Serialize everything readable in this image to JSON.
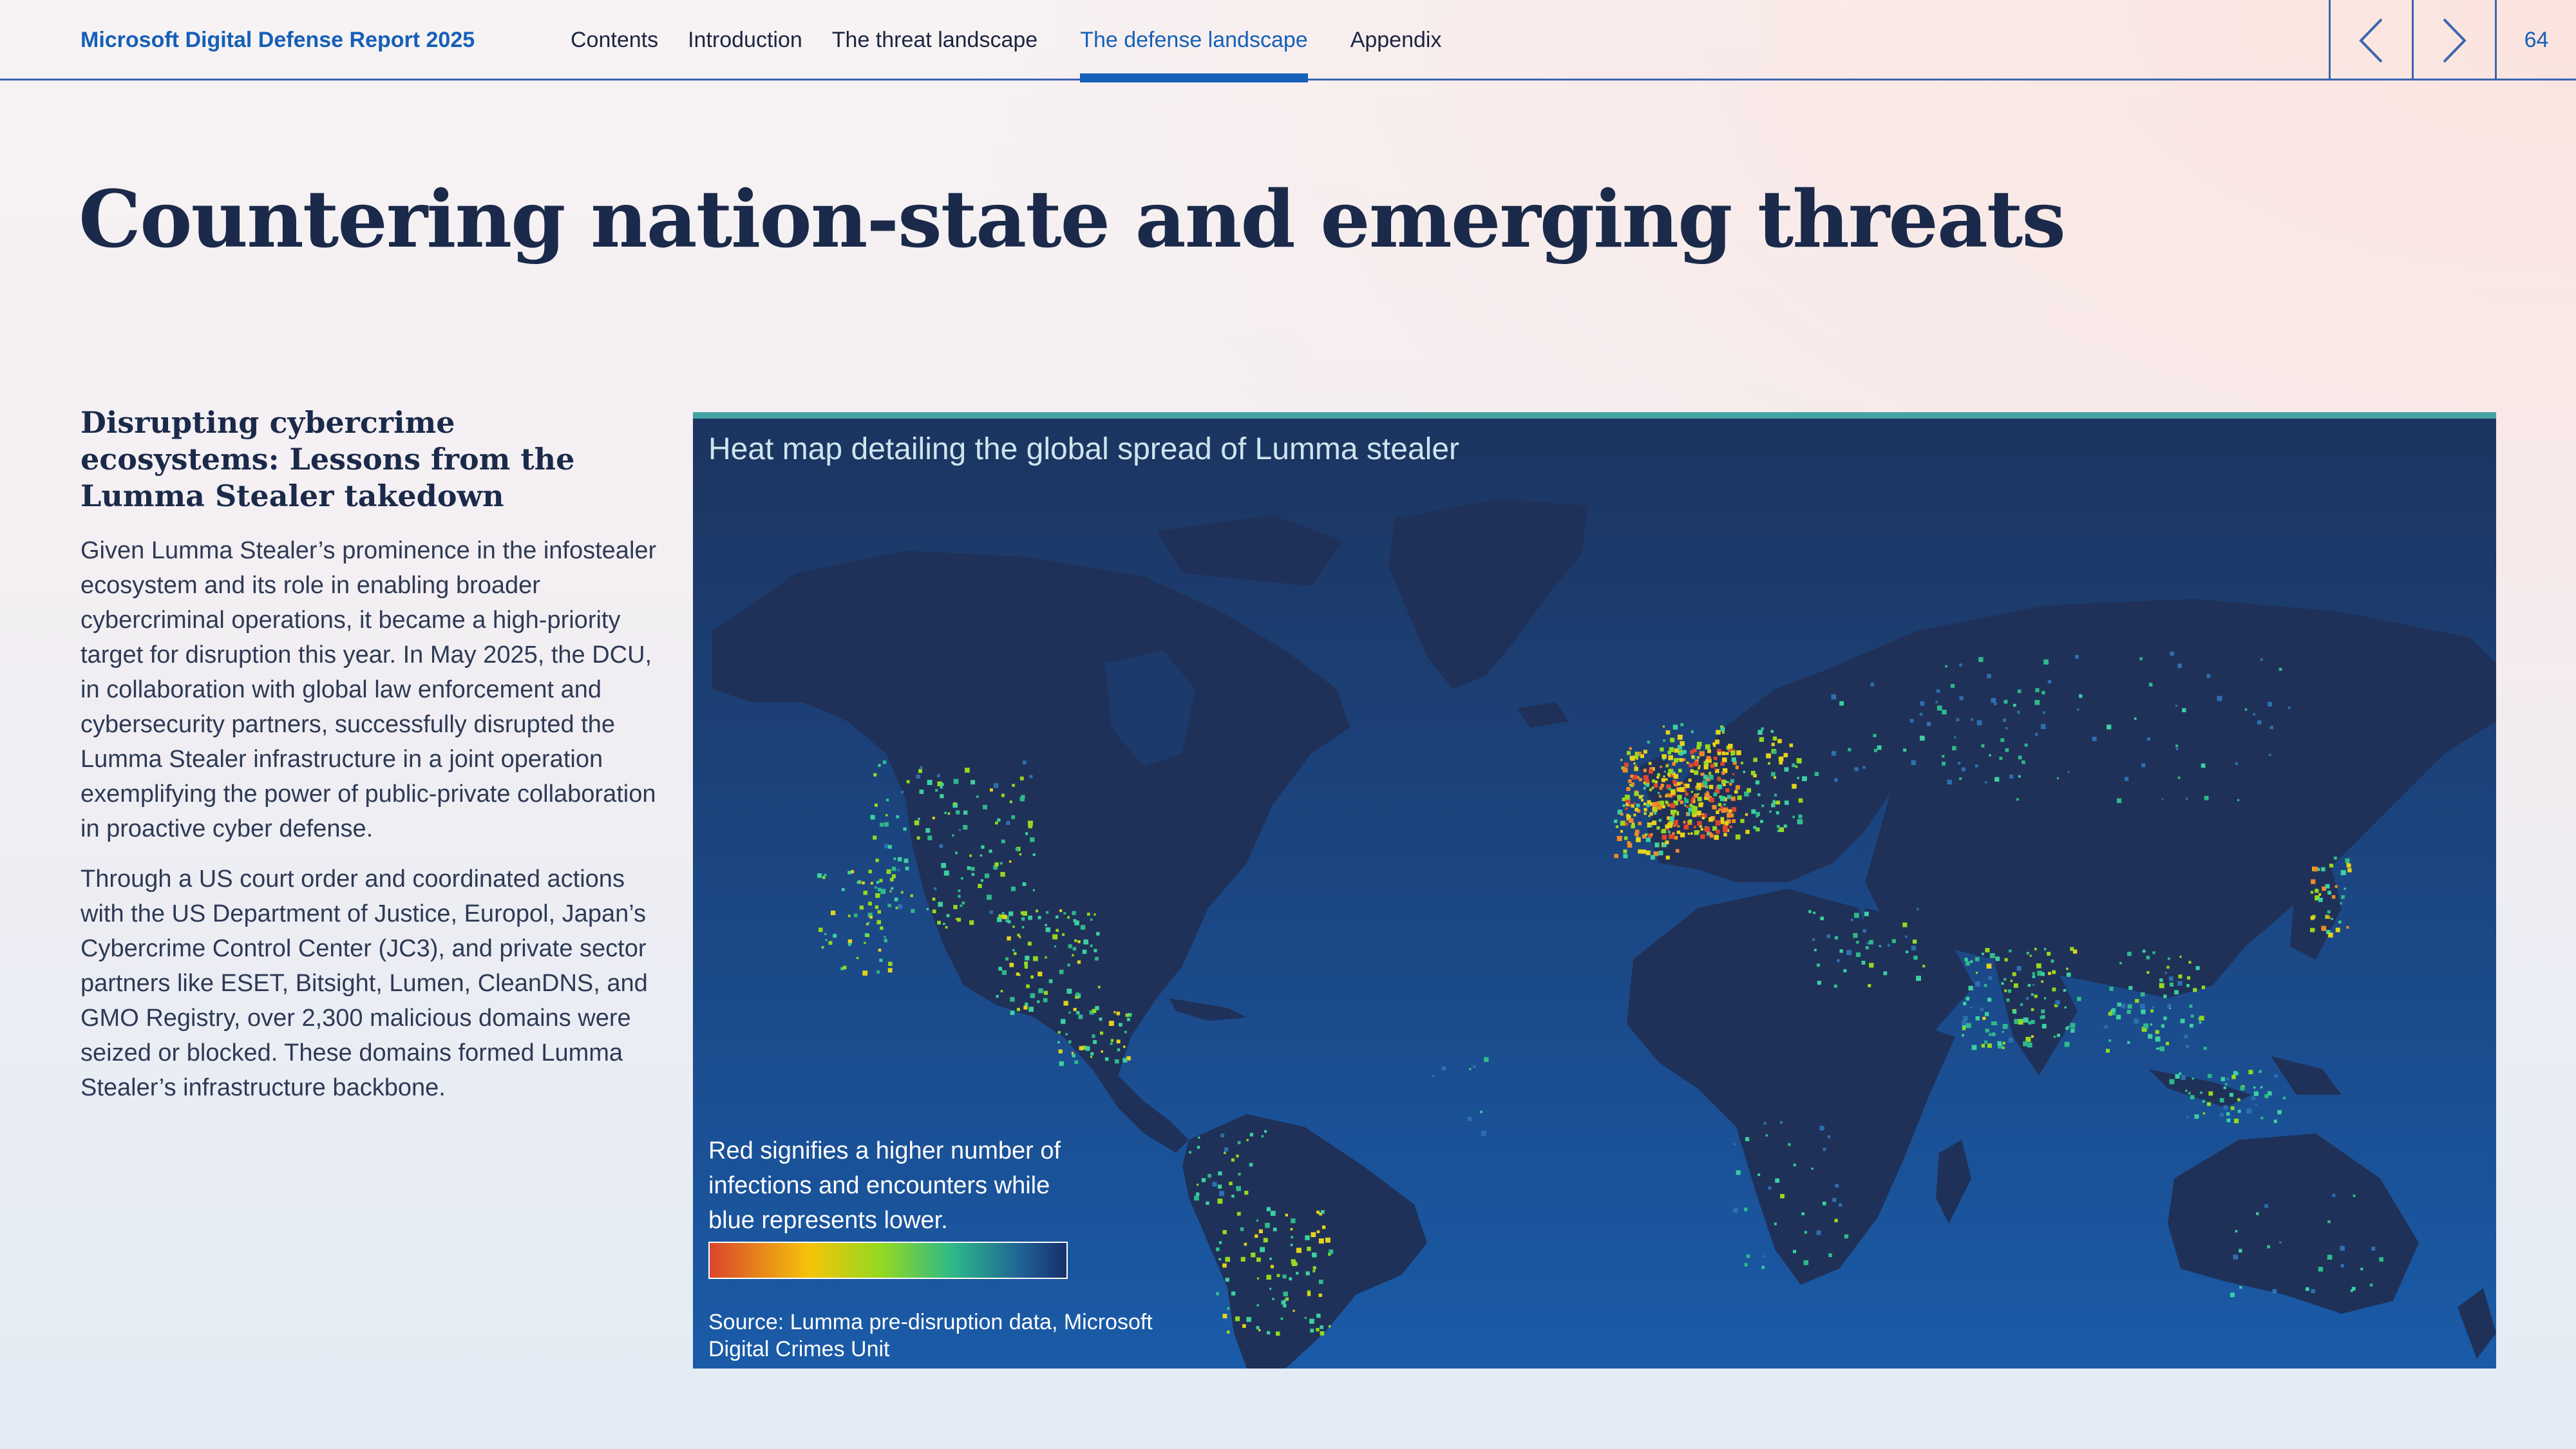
{
  "header": {
    "brand": "Microsoft Digital Defense Report 2025",
    "nav": [
      {
        "label": "Contents",
        "active": false
      },
      {
        "label": "Introduction",
        "active": false
      },
      {
        "label": "The threat landscape",
        "active": false
      },
      {
        "label": "The defense landscape",
        "active": true
      },
      {
        "label": "Appendix",
        "active": false
      }
    ],
    "prev_icon": "chevron-left-icon",
    "next_icon": "chevron-right-icon",
    "page_number": "64"
  },
  "page_title": "Countering nation-state and emerging threats",
  "section": {
    "heading": "Disrupting cybercrime ecosystems: Lessons from the Lumma Stealer takedown",
    "paragraphs": [
      "Given Lumma Stealer’s prominence in the infostealer ecosystem and its role in enabling broader cybercriminal operations, it became a high-priority target for disruption this year. In May 2025, the DCU, in collaboration with global law enforcement and cybersecurity partners, successfully disrupted the Lumma Stealer infrastructure in a joint operation exemplifying the power of public-private collaboration in proactive cyber defense.",
      "Through a US court order and coordinated actions with the US Department of Justice, Europol, Japan’s Cybercrime Control Center (JC3), and private sector partners like ESET, Bitsight, Lumen, CleanDNS, and GMO Registry, over 2,300 malicious domains were seized or blocked. These domains formed Lumma Stealer’s infrastructure backbone."
    ]
  },
  "map": {
    "title": "Heat map detailing the global spread of Lumma stealer",
    "legend_text": "Red signifies a higher number of infections and encounters while blue represents lower.",
    "source": "Source: Lumma pre-disruption data, Microsoft Digital Crimes Unit",
    "colors": {
      "accent_top": "#44a3a3",
      "land": "#1f3158",
      "scale": [
        "#d9452d",
        "#f5c40a",
        "#93d91f",
        "#2eb98a",
        "#1f5f95",
        "#17306a"
      ]
    }
  }
}
